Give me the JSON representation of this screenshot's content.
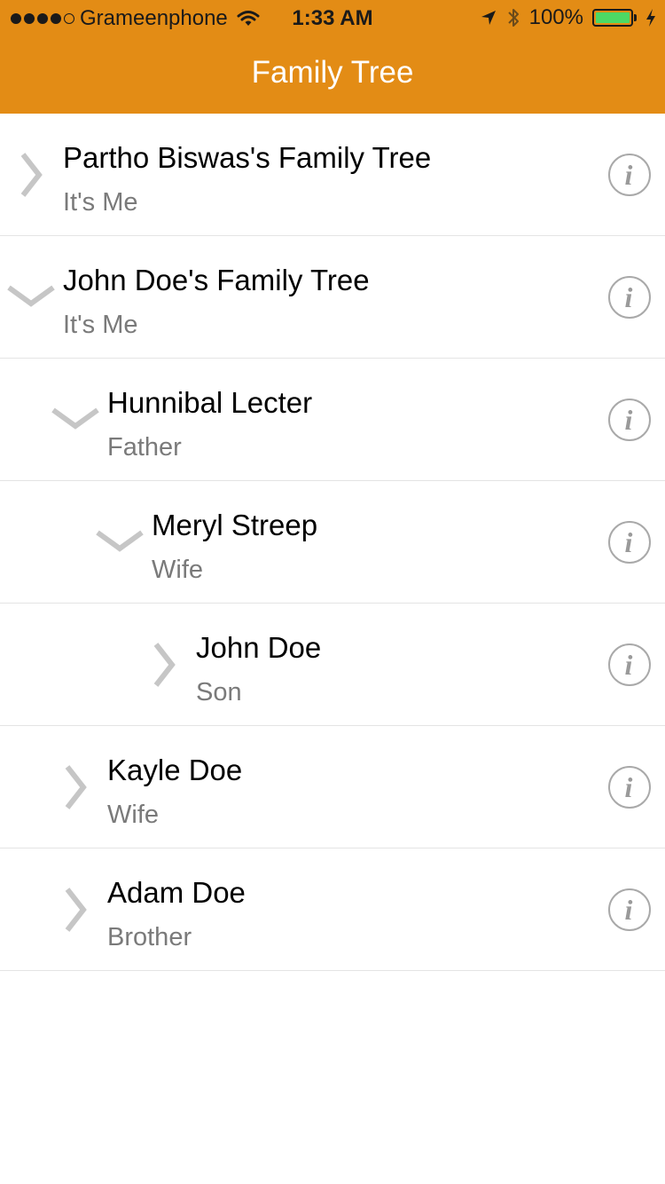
{
  "status_bar": {
    "carrier": "Grameenphone",
    "time": "1:33 AM",
    "battery_percent": "100%",
    "signal_bars_filled": 4,
    "signal_bars_total": 5
  },
  "nav": {
    "title": "Family Tree",
    "background_color": "#E38C15"
  },
  "rows": [
    {
      "name": "Partho Biswas's Family Tree",
      "relation": "It's Me",
      "expanded": false,
      "depth": 0
    },
    {
      "name": "John Doe's Family Tree",
      "relation": "It's Me",
      "expanded": true,
      "depth": 0
    },
    {
      "name": "Hunnibal Lecter",
      "relation": "Father",
      "expanded": true,
      "depth": 1
    },
    {
      "name": "Meryl Streep",
      "relation": "Wife",
      "expanded": true,
      "depth": 2
    },
    {
      "name": "John Doe",
      "relation": "Son",
      "expanded": false,
      "depth": 3
    },
    {
      "name": "Kayle Doe",
      "relation": "Wife",
      "expanded": false,
      "depth": 1
    },
    {
      "name": "Adam Doe",
      "relation": "Brother",
      "expanded": false,
      "depth": 1
    }
  ],
  "icons": {
    "row_info": "info-icon",
    "collapsed": "chevron-right-icon",
    "expanded": "chevron-down-icon"
  }
}
